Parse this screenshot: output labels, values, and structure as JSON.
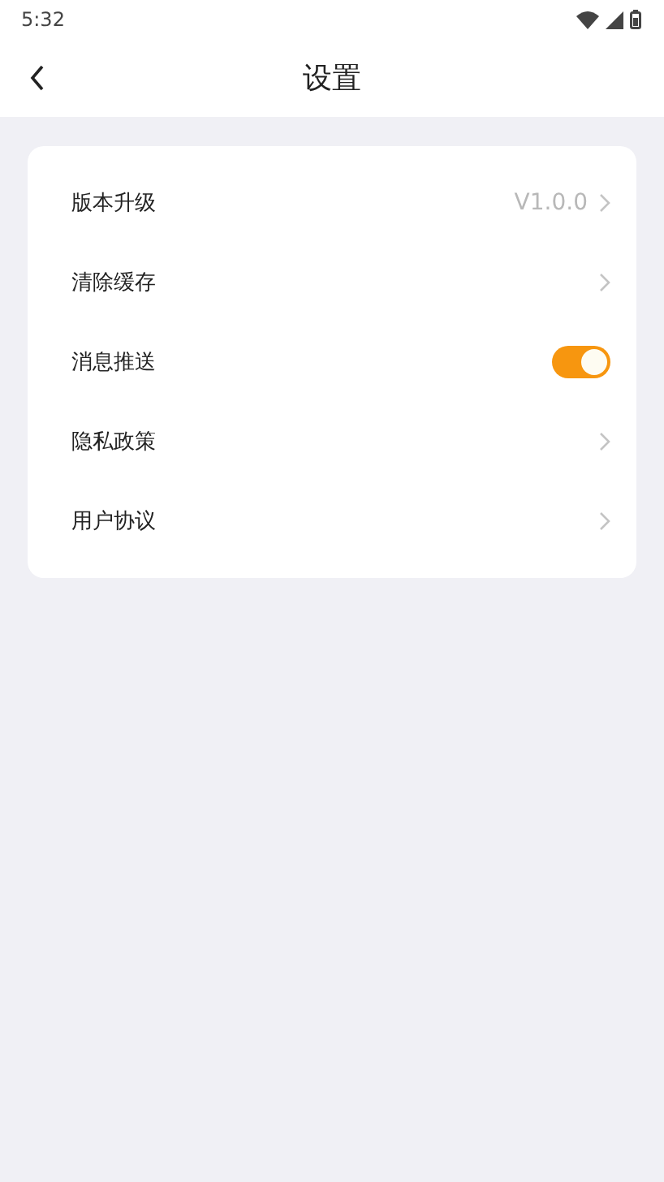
{
  "status_bar": {
    "time": "5:32"
  },
  "header": {
    "title": "设置"
  },
  "settings": [
    {
      "kind": "link",
      "label": "版本升级",
      "value": "V1.0.0"
    },
    {
      "kind": "link",
      "label": "清除缓存"
    },
    {
      "kind": "switch",
      "label": "消息推送",
      "on": true
    },
    {
      "kind": "link",
      "label": "隐私政策"
    },
    {
      "kind": "link",
      "label": "用户协议"
    }
  ]
}
